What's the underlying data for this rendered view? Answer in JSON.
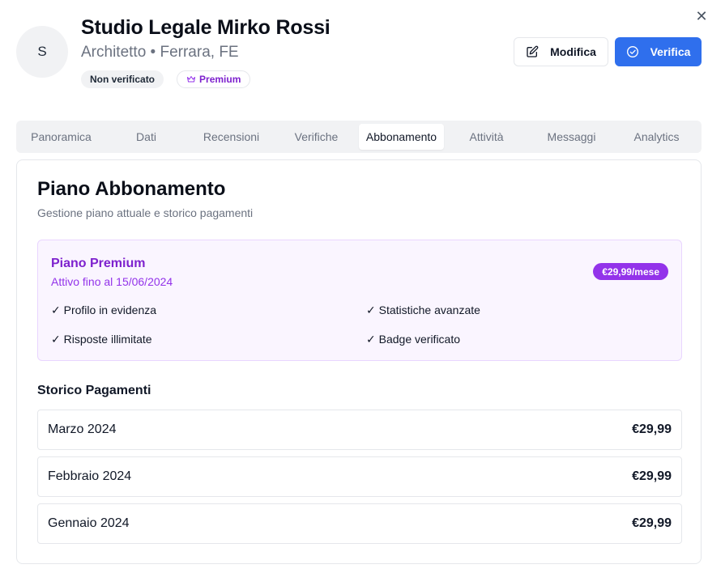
{
  "dialog": {
    "close_icon": "close-icon"
  },
  "profile": {
    "avatar_initial": "S",
    "name": "Studio Legale Mirko Rossi",
    "subtitle": "Architetto • Ferrara, FE",
    "badges": {
      "status": "Non verificato",
      "premium": "Premium",
      "premium_icon": "crown-icon"
    }
  },
  "actions": {
    "edit_label": "Modifica",
    "edit_icon": "edit-icon",
    "verify_label": "Verifica",
    "verify_icon": "check-circle-icon"
  },
  "tabs": [
    {
      "label": "Panoramica",
      "active": false
    },
    {
      "label": "Dati",
      "active": false
    },
    {
      "label": "Recensioni",
      "active": false
    },
    {
      "label": "Verifiche",
      "active": false
    },
    {
      "label": "Abbonamento",
      "active": true
    },
    {
      "label": "Attività",
      "active": false
    },
    {
      "label": "Messaggi",
      "active": false
    },
    {
      "label": "Analytics",
      "active": false
    }
  ],
  "subscription": {
    "title": "Piano Abbonamento",
    "description": "Gestione piano attuale e storico pagamenti",
    "plan": {
      "name": "Piano Premium",
      "active_until": "Attivo fino al 15/06/2024",
      "price": "€29,99/mese",
      "features": [
        "✓ Profilo in evidenza",
        "✓ Statistiche avanzate",
        "✓ Risposte illimitate",
        "✓ Badge verificato"
      ]
    },
    "history_title": "Storico Pagamenti",
    "payments": [
      {
        "month": "Marzo 2024",
        "amount": "€29,99"
      },
      {
        "month": "Febbraio 2024",
        "amount": "€29,99"
      },
      {
        "month": "Gennaio 2024",
        "amount": "€29,99"
      }
    ]
  },
  "colors": {
    "accent": "#2f6fed",
    "premium": "#9333ea",
    "premium_bg": "#faf5ff"
  }
}
